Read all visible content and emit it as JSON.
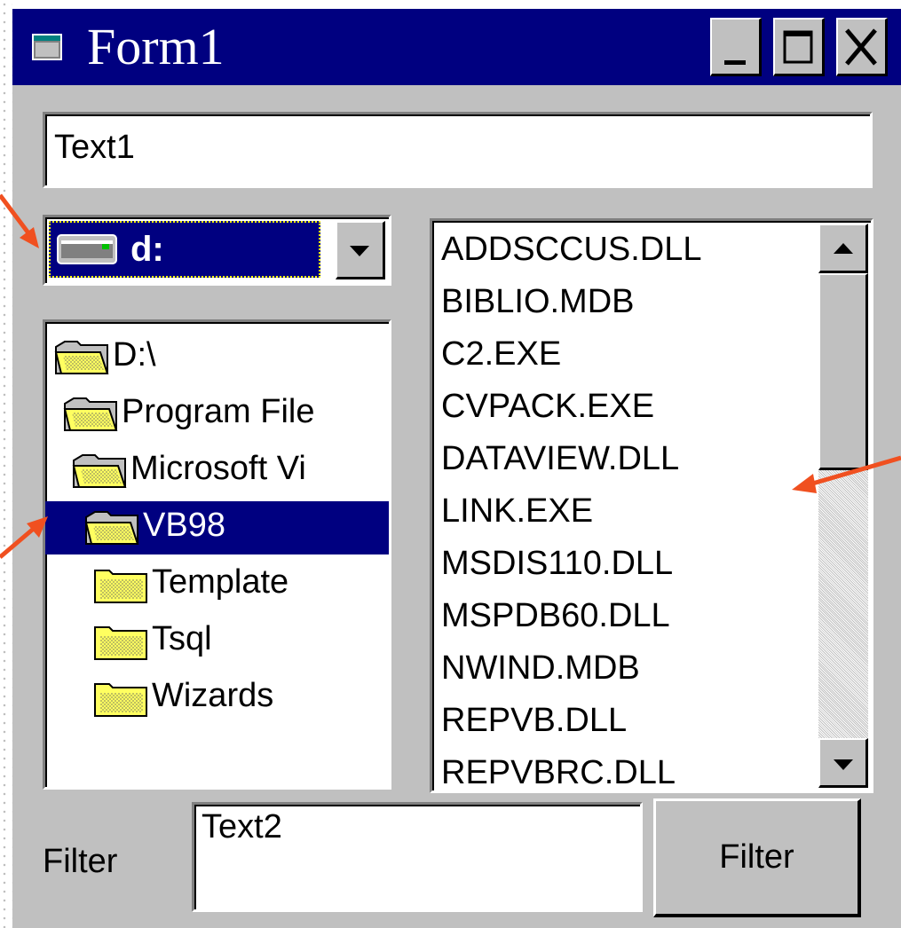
{
  "window": {
    "title": "Form1"
  },
  "titlebar_buttons": [
    {
      "name": "minimize-button",
      "icon": "minimize-icon"
    },
    {
      "name": "maximize-button",
      "icon": "maximize-icon"
    },
    {
      "name": "close-button",
      "icon": "close-icon"
    }
  ],
  "text1": {
    "value": "Text1"
  },
  "drive": {
    "selected": "d:",
    "icon": "hard-drive-icon"
  },
  "directories": [
    {
      "label": "D:\\",
      "icon": "open-folder-icon"
    },
    {
      "label": "Program File",
      "icon": "open-folder-icon"
    },
    {
      "label": "Microsoft Vi",
      "icon": "open-folder-icon"
    },
    {
      "label": "VB98",
      "icon": "open-folder-icon",
      "selected": true
    },
    {
      "label": "Template",
      "icon": "folder-icon"
    },
    {
      "label": "Tsql",
      "icon": "folder-icon"
    },
    {
      "label": "Wizards",
      "icon": "folder-icon"
    }
  ],
  "files": [
    "ADDSCCUS.DLL",
    "BIBLIO.MDB",
    "C2.EXE",
    "CVPACK.EXE",
    "DATAVIEW.DLL",
    "LINK.EXE",
    "MSDIS110.DLL",
    "MSPDB60.DLL",
    "NWIND.MDB",
    "REPVB.DLL",
    "REPVBRC.DLL"
  ],
  "filter": {
    "label": "Filter",
    "input_value": "Text2",
    "button_label": "Filter"
  },
  "colors": {
    "titlebar": "#000080",
    "face": "#c0c0c0",
    "selection": "#000080",
    "annotation_arrow": "#f05020"
  }
}
